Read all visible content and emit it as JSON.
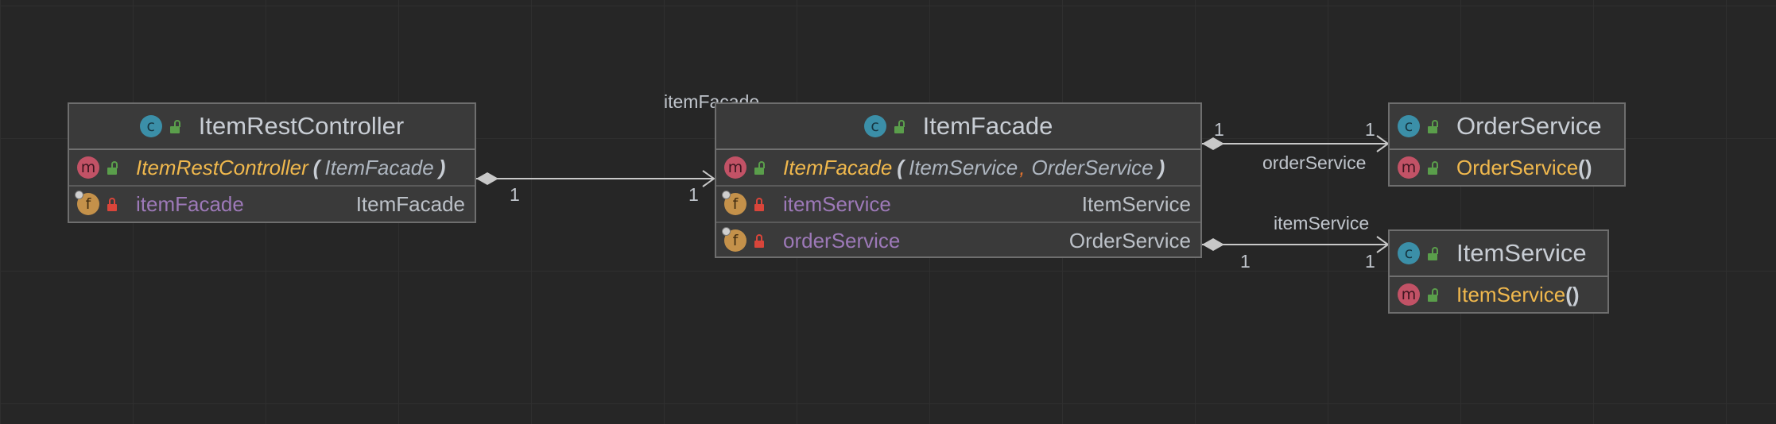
{
  "nodes": {
    "item_rest_controller": {
      "title": "ItemRestController",
      "constructor": {
        "name": "ItemRestController",
        "params": [
          "ItemFacade"
        ]
      },
      "fields": [
        {
          "name": "itemFacade",
          "type": "ItemFacade"
        }
      ]
    },
    "item_facade": {
      "title": "ItemFacade",
      "constructor": {
        "name": "ItemFacade",
        "params": [
          "ItemService",
          "OrderService"
        ]
      },
      "fields": [
        {
          "name": "itemService",
          "type": "ItemService"
        },
        {
          "name": "orderService",
          "type": "OrderService"
        }
      ]
    },
    "order_service": {
      "title": "OrderService",
      "constructor": {
        "name": "OrderService",
        "paren": "()"
      }
    },
    "item_service": {
      "title": "ItemService",
      "constructor": {
        "name": "ItemService",
        "paren": "()"
      }
    }
  },
  "badges": {
    "class": "c",
    "method": "m",
    "field": "f"
  },
  "edges": {
    "controller_to_facade": {
      "label": "itemFacade",
      "source_mult": "1",
      "target_mult": "1"
    },
    "facade_to_order_service": {
      "label": "orderService",
      "source_mult": "1",
      "target_mult": "1"
    },
    "facade_to_item_service": {
      "label": "itemService",
      "source_mult": "1",
      "target_mult": "1"
    }
  },
  "colors": {
    "background": "#262626",
    "class_badge": "#3b8fa8",
    "method_badge": "#c25266",
    "field_badge": "#c4914a",
    "method_name": "#f0b84d",
    "field_name": "#9d79b8",
    "edge": "#c8c8c8"
  }
}
